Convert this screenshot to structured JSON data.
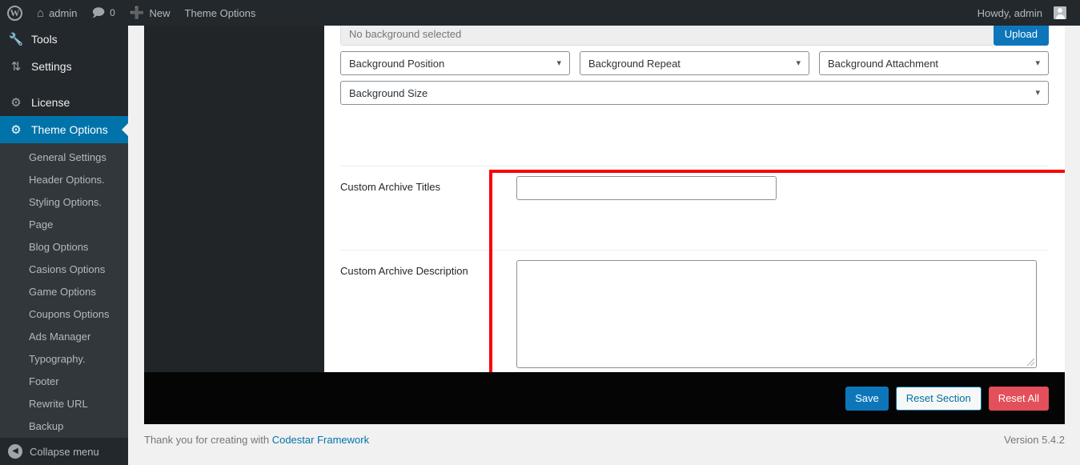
{
  "adminbar": {
    "logo_icon": "wordpress-logo-icon",
    "site_name": "admin",
    "site_icon": "home-icon",
    "comments_icon": "comment-bubble-icon",
    "comments_count": "0",
    "new_icon": "plus-icon",
    "new_label": "New",
    "theme_options_label": "Theme Options",
    "howdy": "Howdy, admin",
    "avatar": "user-avatar"
  },
  "sidebar": {
    "top_items": [
      {
        "label": "Tools",
        "icon": "wrench-icon",
        "current": false
      },
      {
        "label": "Settings",
        "icon": "sliders-icon",
        "current": false
      },
      {
        "label": "License",
        "icon": "gear-icon",
        "current": false
      },
      {
        "label": "Theme Options",
        "icon": "gear-icon",
        "current": true
      }
    ],
    "submenu": [
      "General Settings",
      "Header Options.",
      "Styling Options.",
      "Page",
      "Blog Options",
      "Casions Options",
      "Game Options",
      "Coupons Options",
      "Ads Manager",
      "Typography.",
      "Footer",
      "Rewrite URL",
      "Backup"
    ],
    "collapse_label": "Collapse menu",
    "collapse_icon": "chevron-left-circle-icon"
  },
  "media_field": {
    "upload_placeholder": "No background selected",
    "upload_button": "Upload",
    "selects": [
      {
        "label": "Background Position",
        "icon": "chevron-down-icon"
      },
      {
        "label": "Background Repeat",
        "icon": "chevron-down-icon"
      },
      {
        "label": "Background Attachment",
        "icon": "chevron-down-icon"
      }
    ],
    "size_select": {
      "label": "Background Size",
      "icon": "chevron-down-icon"
    }
  },
  "fields": [
    {
      "title": "Custom Archive Titles",
      "type": "text",
      "value": ""
    },
    {
      "title": "Custom Archive Description",
      "type": "textarea",
      "value": ""
    }
  ],
  "highlight": {
    "name": "red-annotation-box",
    "color": "#fb0007"
  },
  "actions": {
    "save": "Save",
    "reset_section": "Reset Section",
    "reset_all": "Reset All"
  },
  "footer": {
    "thanks_prefix": "Thank you for creating with ",
    "framework_link": "Codestar Framework",
    "version": "Version 5.4.2"
  },
  "colors": {
    "accent_blue": "#0073aa",
    "button_blue": "#0d76ba",
    "danger_red": "#e34f5a",
    "highlight_red": "#fb0007",
    "admin_dark": "#23282d",
    "nav_dark": "#222528",
    "footer_black": "#050505"
  }
}
